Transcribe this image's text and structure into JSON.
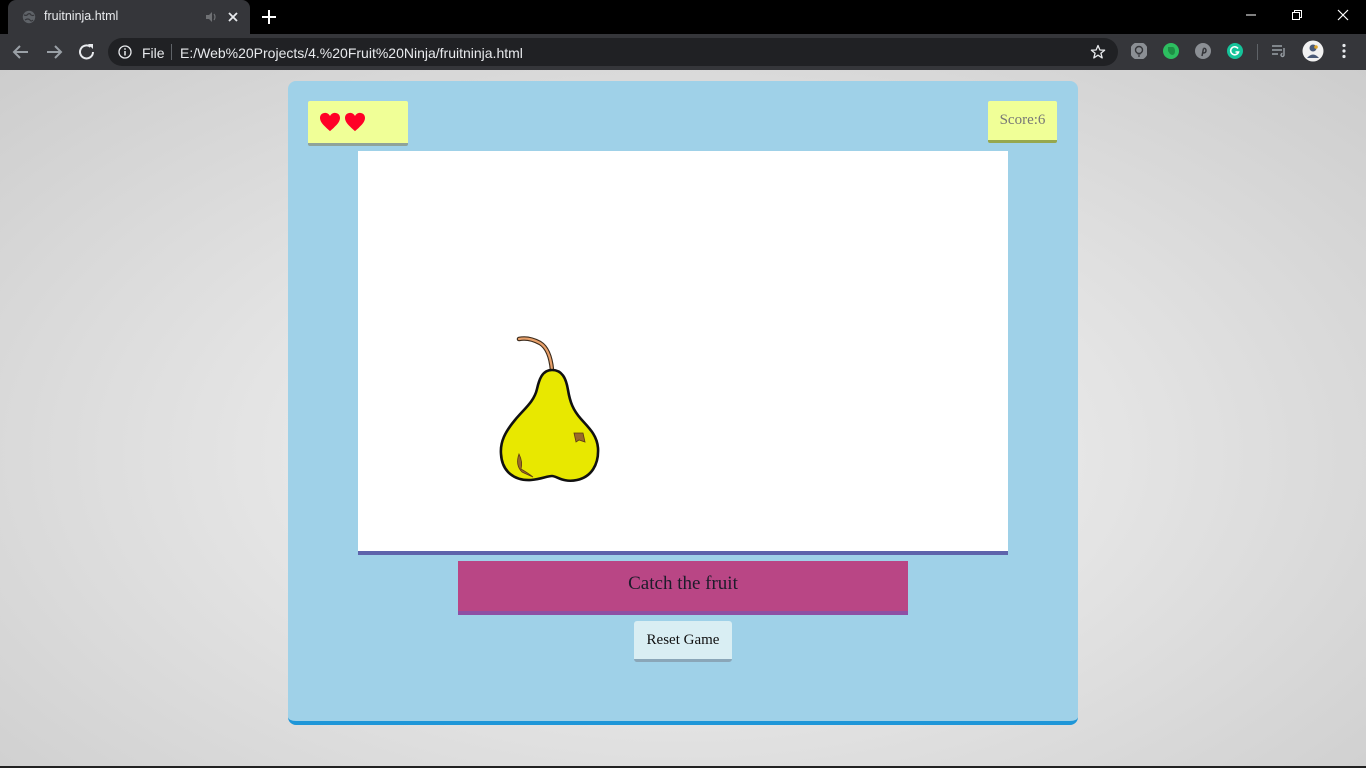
{
  "browser": {
    "tab": {
      "title": "fruitninja.html"
    },
    "address": {
      "scheme": "File",
      "url": "E:/Web%20Projects/4.%20Fruit%20Ninja/fruitninja.html"
    }
  },
  "game": {
    "lives": {
      "count": 2,
      "icon": "heart-icon",
      "color": "#ff0026"
    },
    "score_text": "Score:6",
    "current_fruit": "pear-icon",
    "instruction": "Catch the fruit",
    "reset_label": "Reset Game"
  },
  "colors": {
    "container": "#9fd1e8",
    "panel": "#f0ff97",
    "instruction_bg": "#b94685",
    "game_bg": "#ffffff"
  }
}
